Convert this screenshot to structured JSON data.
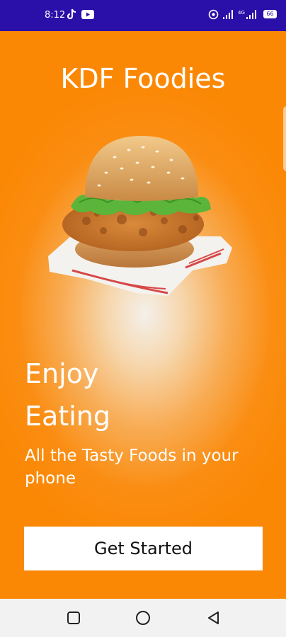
{
  "status_bar": {
    "time": "8:12",
    "battery": "66",
    "icons": [
      "tiktok-icon",
      "youtube-icon",
      "hotspot-icon",
      "signal-icon",
      "signal-icon",
      "battery-icon"
    ]
  },
  "app": {
    "title": "KDF Foodies"
  },
  "hero": {
    "image": "burger-image",
    "headline_line1": "Enjoy",
    "headline_line2": "Eating",
    "subtitle": "All the Tasty Foods in your phone"
  },
  "cta": {
    "label": "Get Started"
  },
  "nav": {
    "icons": [
      "recents-square-icon",
      "home-circle-icon",
      "back-triangle-icon"
    ]
  },
  "colors": {
    "status_bar": "#2a0fa8",
    "accent_orange": "#fb8805",
    "button_bg": "#ffffff"
  }
}
